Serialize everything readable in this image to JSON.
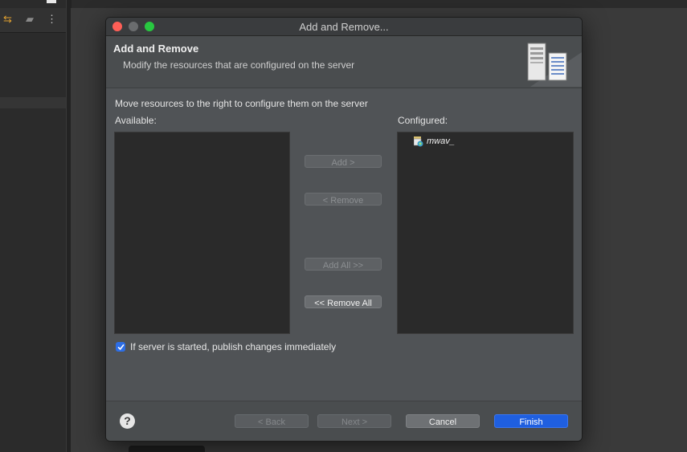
{
  "window": {
    "title": "Add and Remove..."
  },
  "header": {
    "title": "Add and Remove",
    "description": "Modify the resources that are configured on the server"
  },
  "body": {
    "instruction": "Move resources to the right to configure them on the server",
    "available_label": "Available:",
    "configured_label": "Configured:",
    "available_items": [],
    "configured_items": [
      {
        "label": "mwav_",
        "icon": "web-module-icon"
      }
    ]
  },
  "buttons": {
    "add": "Add >",
    "remove": "< Remove",
    "add_all": "Add All >>",
    "remove_all": "<< Remove All"
  },
  "checkbox": {
    "label": "If server is started, publish changes immediately",
    "checked": true
  },
  "footer": {
    "help": "?",
    "back": "< Back",
    "next": "Next >",
    "cancel": "Cancel",
    "finish": "Finish"
  },
  "colors": {
    "primary_button": "#1f5fe0",
    "checkbox": "#2d6ee6",
    "close": "#ff5f57",
    "maximize": "#28c840"
  }
}
